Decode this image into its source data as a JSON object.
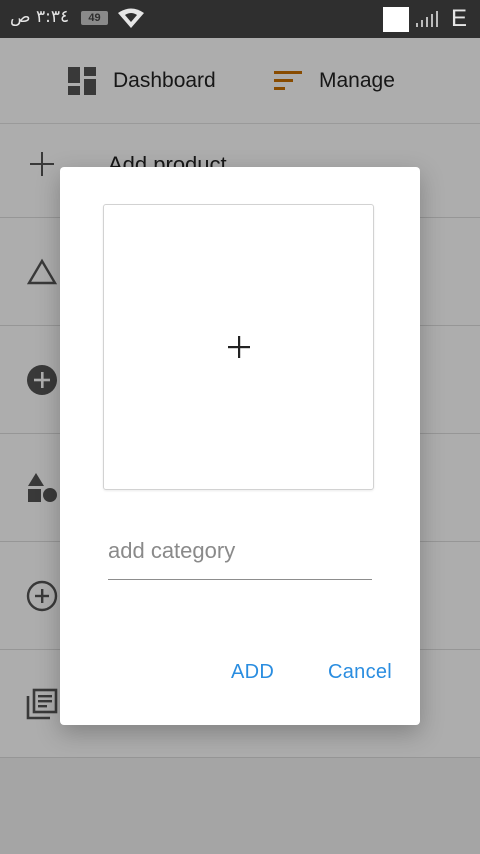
{
  "status_bar": {
    "time": "٣:٣٤ ص",
    "battery": "49",
    "network": "E",
    "icons": [
      "wifi-icon",
      "signal-icon"
    ]
  },
  "nav": {
    "dashboard_label": "Dashboard",
    "manage_label": "Manage",
    "icons": [
      "dashboard-icon",
      "manage-sort-icon"
    ],
    "manage_icon_color": "#c96f00"
  },
  "list": {
    "items": [
      {
        "label": "Add product",
        "icon": "plus-icon"
      },
      {
        "label": "",
        "icon": "triangle-icon"
      },
      {
        "label": "",
        "icon": "add-circle-filled-icon"
      },
      {
        "label": "",
        "icon": "category-shapes-icon"
      },
      {
        "label": "",
        "icon": "add-circle-outline-icon"
      },
      {
        "label": "",
        "icon": "library-books-icon"
      }
    ]
  },
  "dialog": {
    "image_picker_icon": "plus-icon",
    "category_placeholder": "add category",
    "category_value": "",
    "add_label": "ADD",
    "cancel_label": "Cancel",
    "accent_color": "#2a8de0"
  }
}
